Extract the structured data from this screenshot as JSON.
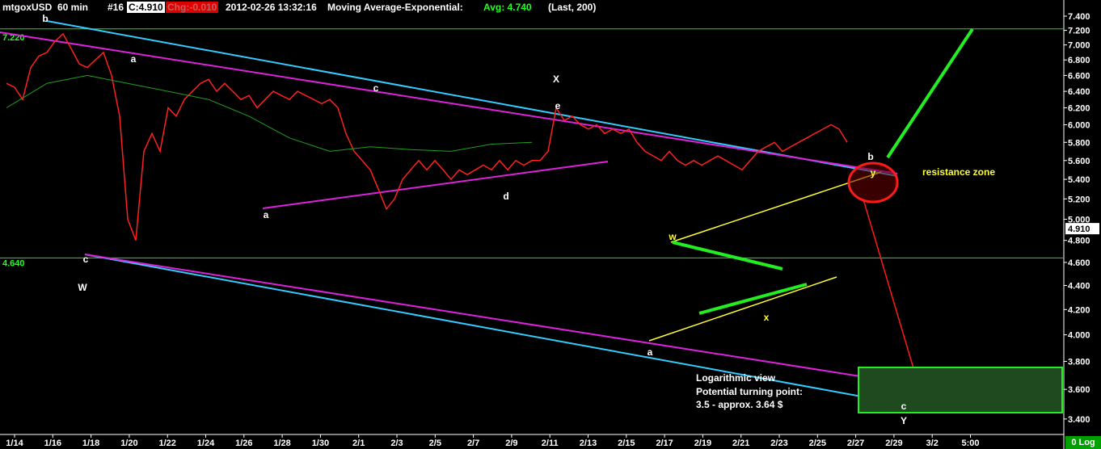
{
  "header": {
    "symbol": "mtgoxUSD",
    "interval": "60 min",
    "bar_no": "#16",
    "last": "C:4.910",
    "change": "Chg:-0.010",
    "datetime": "2012-02-26 13:32:16",
    "indicator": "Moving Average-Exponential:",
    "avg": "Avg: 4.740",
    "params": "(Last, 200)"
  },
  "footer": {
    "log_label": "0 Log"
  },
  "colors": {
    "background": "#000000",
    "price": "#ff2020",
    "price_up": "#20ff20",
    "moving_average": "#1fa01f",
    "channel_cyan": "#33ccff",
    "channel_magenta": "#dd22dd",
    "wedge_yellow": "#ffff33",
    "target_green": "#22ee22",
    "circle_red": "#ff1a1a"
  },
  "chart_data": {
    "type": "line",
    "scale": "log",
    "ylim": [
      3.3,
      7.4
    ],
    "yticks": [
      "7.400",
      "7.200",
      "7.000",
      "6.800",
      "6.600",
      "6.400",
      "6.200",
      "6.000",
      "5.800",
      "5.600",
      "5.400",
      "5.200",
      "5.000",
      "4.800",
      "4.600",
      "4.400",
      "4.200",
      "4.000",
      "3.800",
      "3.600",
      "3.400"
    ],
    "xticks": [
      "1/14",
      "1/16",
      "1/18",
      "1/20",
      "1/22",
      "1/24",
      "1/26",
      "1/28",
      "1/30",
      "2/1",
      "2/3",
      "2/5",
      "2/7",
      "2/9",
      "2/11",
      "2/13",
      "2/15",
      "2/17",
      "2/19",
      "2/21",
      "2/23",
      "2/25",
      "2/27",
      "2/29",
      "3/2",
      "5:00"
    ],
    "xlim": [
      0,
      52
    ],
    "hlines": [
      {
        "label": "7.220",
        "value": 7.22
      },
      {
        "label": "4.640",
        "value": 4.64
      }
    ],
    "last_price": {
      "value": 4.91,
      "label": "4.910"
    },
    "series": [
      {
        "values": [
          [
            0,
            6.5
          ],
          [
            0.5,
            6.45
          ],
          [
            1,
            6.3
          ],
          [
            1.5,
            6.7
          ],
          [
            2,
            6.85
          ],
          [
            2.5,
            6.9
          ],
          [
            3,
            7.05
          ],
          [
            3.5,
            7.15
          ],
          [
            4,
            6.95
          ],
          [
            4.5,
            6.75
          ],
          [
            5,
            6.7
          ],
          [
            5.5,
            6.8
          ],
          [
            6,
            6.9
          ],
          [
            6.5,
            6.6
          ],
          [
            7,
            6.1
          ],
          [
            7.5,
            5.0
          ],
          [
            8,
            4.8
          ],
          [
            8.5,
            5.7
          ],
          [
            9,
            5.9
          ],
          [
            9.5,
            5.7
          ],
          [
            10,
            6.2
          ],
          [
            10.5,
            6.1
          ],
          [
            11,
            6.3
          ],
          [
            11.5,
            6.4
          ],
          [
            12,
            6.5
          ],
          [
            12.5,
            6.55
          ],
          [
            13,
            6.4
          ],
          [
            13.5,
            6.5
          ],
          [
            14,
            6.4
          ],
          [
            14.5,
            6.3
          ],
          [
            15,
            6.35
          ],
          [
            15.5,
            6.2
          ],
          [
            16,
            6.3
          ],
          [
            16.5,
            6.4
          ],
          [
            17,
            6.35
          ],
          [
            17.5,
            6.3
          ],
          [
            18,
            6.4
          ],
          [
            18.5,
            6.35
          ],
          [
            19,
            6.3
          ],
          [
            19.5,
            6.25
          ],
          [
            20,
            6.3
          ],
          [
            20.5,
            6.2
          ],
          [
            21,
            5.9
          ],
          [
            21.5,
            5.7
          ],
          [
            22,
            5.6
          ],
          [
            22.5,
            5.5
          ],
          [
            23,
            5.3
          ],
          [
            23.5,
            5.1
          ],
          [
            24,
            5.2
          ],
          [
            24.5,
            5.4
          ],
          [
            25,
            5.5
          ],
          [
            25.5,
            5.6
          ],
          [
            26,
            5.5
          ],
          [
            26.5,
            5.6
          ],
          [
            27,
            5.5
          ],
          [
            27.5,
            5.4
          ],
          [
            28,
            5.5
          ],
          [
            28.5,
            5.45
          ],
          [
            29,
            5.5
          ],
          [
            29.5,
            5.55
          ],
          [
            30,
            5.5
          ],
          [
            30.5,
            5.6
          ],
          [
            31,
            5.5
          ],
          [
            31.5,
            5.6
          ],
          [
            32,
            5.55
          ],
          [
            32.5,
            5.6
          ],
          [
            33,
            5.6
          ],
          [
            33.5,
            5.7
          ],
          [
            34,
            6.2
          ],
          [
            34.5,
            6.05
          ],
          [
            35,
            6.1
          ],
          [
            35.5,
            6.0
          ],
          [
            36,
            5.95
          ],
          [
            36.5,
            6.0
          ],
          [
            37,
            5.9
          ],
          [
            37.5,
            5.95
          ],
          [
            38,
            5.9
          ],
          [
            38.5,
            5.95
          ],
          [
            39,
            5.8
          ],
          [
            39.5,
            5.7
          ],
          [
            40,
            5.65
          ],
          [
            40.5,
            5.6
          ],
          [
            41,
            5.7
          ],
          [
            41.5,
            5.6
          ],
          [
            42,
            5.55
          ],
          [
            42.5,
            5.6
          ],
          [
            43,
            5.55
          ],
          [
            43.5,
            5.6
          ],
          [
            44,
            5.65
          ],
          [
            44.5,
            5.6
          ],
          [
            45,
            5.55
          ],
          [
            45.5,
            5.5
          ],
          [
            46,
            5.6
          ],
          [
            46.5,
            5.7
          ],
          [
            47,
            5.75
          ],
          [
            47.5,
            5.8
          ],
          [
            48,
            5.7
          ],
          [
            48.5,
            5.75
          ],
          [
            49,
            5.8
          ],
          [
            49.5,
            5.85
          ],
          [
            50,
            5.9
          ],
          [
            50.5,
            5.95
          ],
          [
            51,
            6.0
          ],
          [
            51.5,
            5.95
          ],
          [
            52,
            5.8
          ]
        ]
      }
    ]
  },
  "annotations": [
    {
      "text": "b",
      "color": "#ffffff"
    },
    {
      "text": "a",
      "color": "#ffffff"
    },
    {
      "text": "c",
      "color": "#ffffff"
    },
    {
      "text": "W",
      "color": "#ffffff"
    },
    {
      "text": "a",
      "color": "#ffffff"
    },
    {
      "text": "c",
      "color": "#ffffff"
    },
    {
      "text": "d",
      "color": "#ffffff"
    },
    {
      "text": "X",
      "color": "#ffffff"
    },
    {
      "text": "e",
      "color": "#ffffff"
    },
    {
      "text": "w",
      "color": "#ffff33"
    },
    {
      "text": "x",
      "color": "#ffff33"
    },
    {
      "text": "a",
      "color": "#ffffff"
    },
    {
      "text": "y",
      "color": "#ffff33"
    },
    {
      "text": "b",
      "color": "#ffffff"
    },
    {
      "text": "c",
      "color": "#ffffff"
    },
    {
      "text": "Y",
      "color": "#ffffff"
    },
    {
      "text": "resistance zone",
      "color": "#ffff33"
    }
  ],
  "note": {
    "line1": "Logarithmic view",
    "line2": "Potential turning point:",
    "line3": "3.5 - approx. 3.64 $"
  }
}
